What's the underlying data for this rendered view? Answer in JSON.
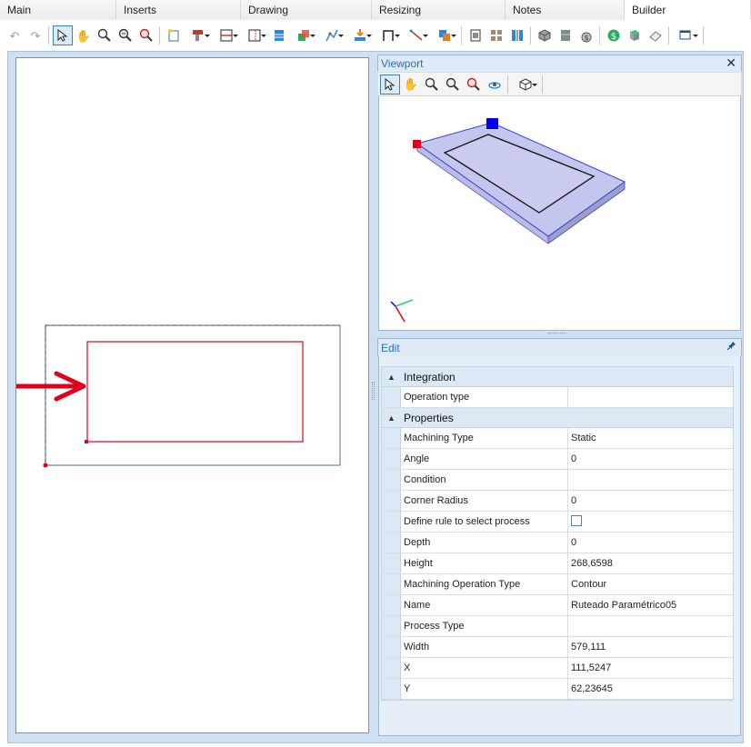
{
  "tabs": [
    "Main",
    "Inserts",
    "Drawing",
    "Resizing",
    "Notes",
    "Builder"
  ],
  "active_tab": "Builder",
  "toolbar": {
    "icons": [
      "undo-icon",
      "redo-icon",
      "select-arrow-icon",
      "pan-hand-icon",
      "zoom-extents-icon",
      "zoom-window-icon",
      "zoom-realtime-icon",
      "new-part-icon",
      "drill-tool-icon",
      "panel-divider-icon",
      "door-frame-icon",
      "shelf-icon",
      "color-part-icon",
      "path-tool-icon",
      "insert-down-icon",
      "frame-icon",
      "line-tool-icon",
      "group-icon",
      "schedule-icon",
      "grid-icon",
      "columns-icon",
      "box-3d-icon",
      "cabinet-icon",
      "money-bag-icon",
      "dollar-icon",
      "cube-switch-icon",
      "eraser-icon",
      "window-layout-icon"
    ]
  },
  "viewport": {
    "title": "Viewport",
    "close": "✕"
  },
  "edit": {
    "title": "Edit",
    "pin": "📌",
    "sections": [
      {
        "label": "Integration",
        "rows": [
          {
            "name": "Operation type",
            "value": ""
          }
        ]
      },
      {
        "label": "Properties",
        "rows": [
          {
            "name": "Machining Type",
            "value": "Static"
          },
          {
            "name": "Angle",
            "value": "0"
          },
          {
            "name": "Condition",
            "value": ""
          },
          {
            "name": "Corner Radius",
            "value": "0"
          },
          {
            "name": "Define rule to select process",
            "value": "",
            "checkbox": true
          },
          {
            "name": "Depth",
            "value": "0"
          },
          {
            "name": "Height",
            "value": "268,6598"
          },
          {
            "name": "Machining Operation Type",
            "value": "Contour"
          },
          {
            "name": "Name",
            "value": "Ruteado Paramétrico05"
          },
          {
            "name": "Process Type",
            "value": ""
          },
          {
            "name": "Width",
            "value": "579,111"
          },
          {
            "name": "X",
            "value": "111,5247"
          },
          {
            "name": "Y",
            "value": "62,23645"
          }
        ]
      }
    ]
  },
  "colors": {
    "accent": "#2d6fb6",
    "selection_red": "#e2001a",
    "panel_blue": "#cfe0f3"
  }
}
